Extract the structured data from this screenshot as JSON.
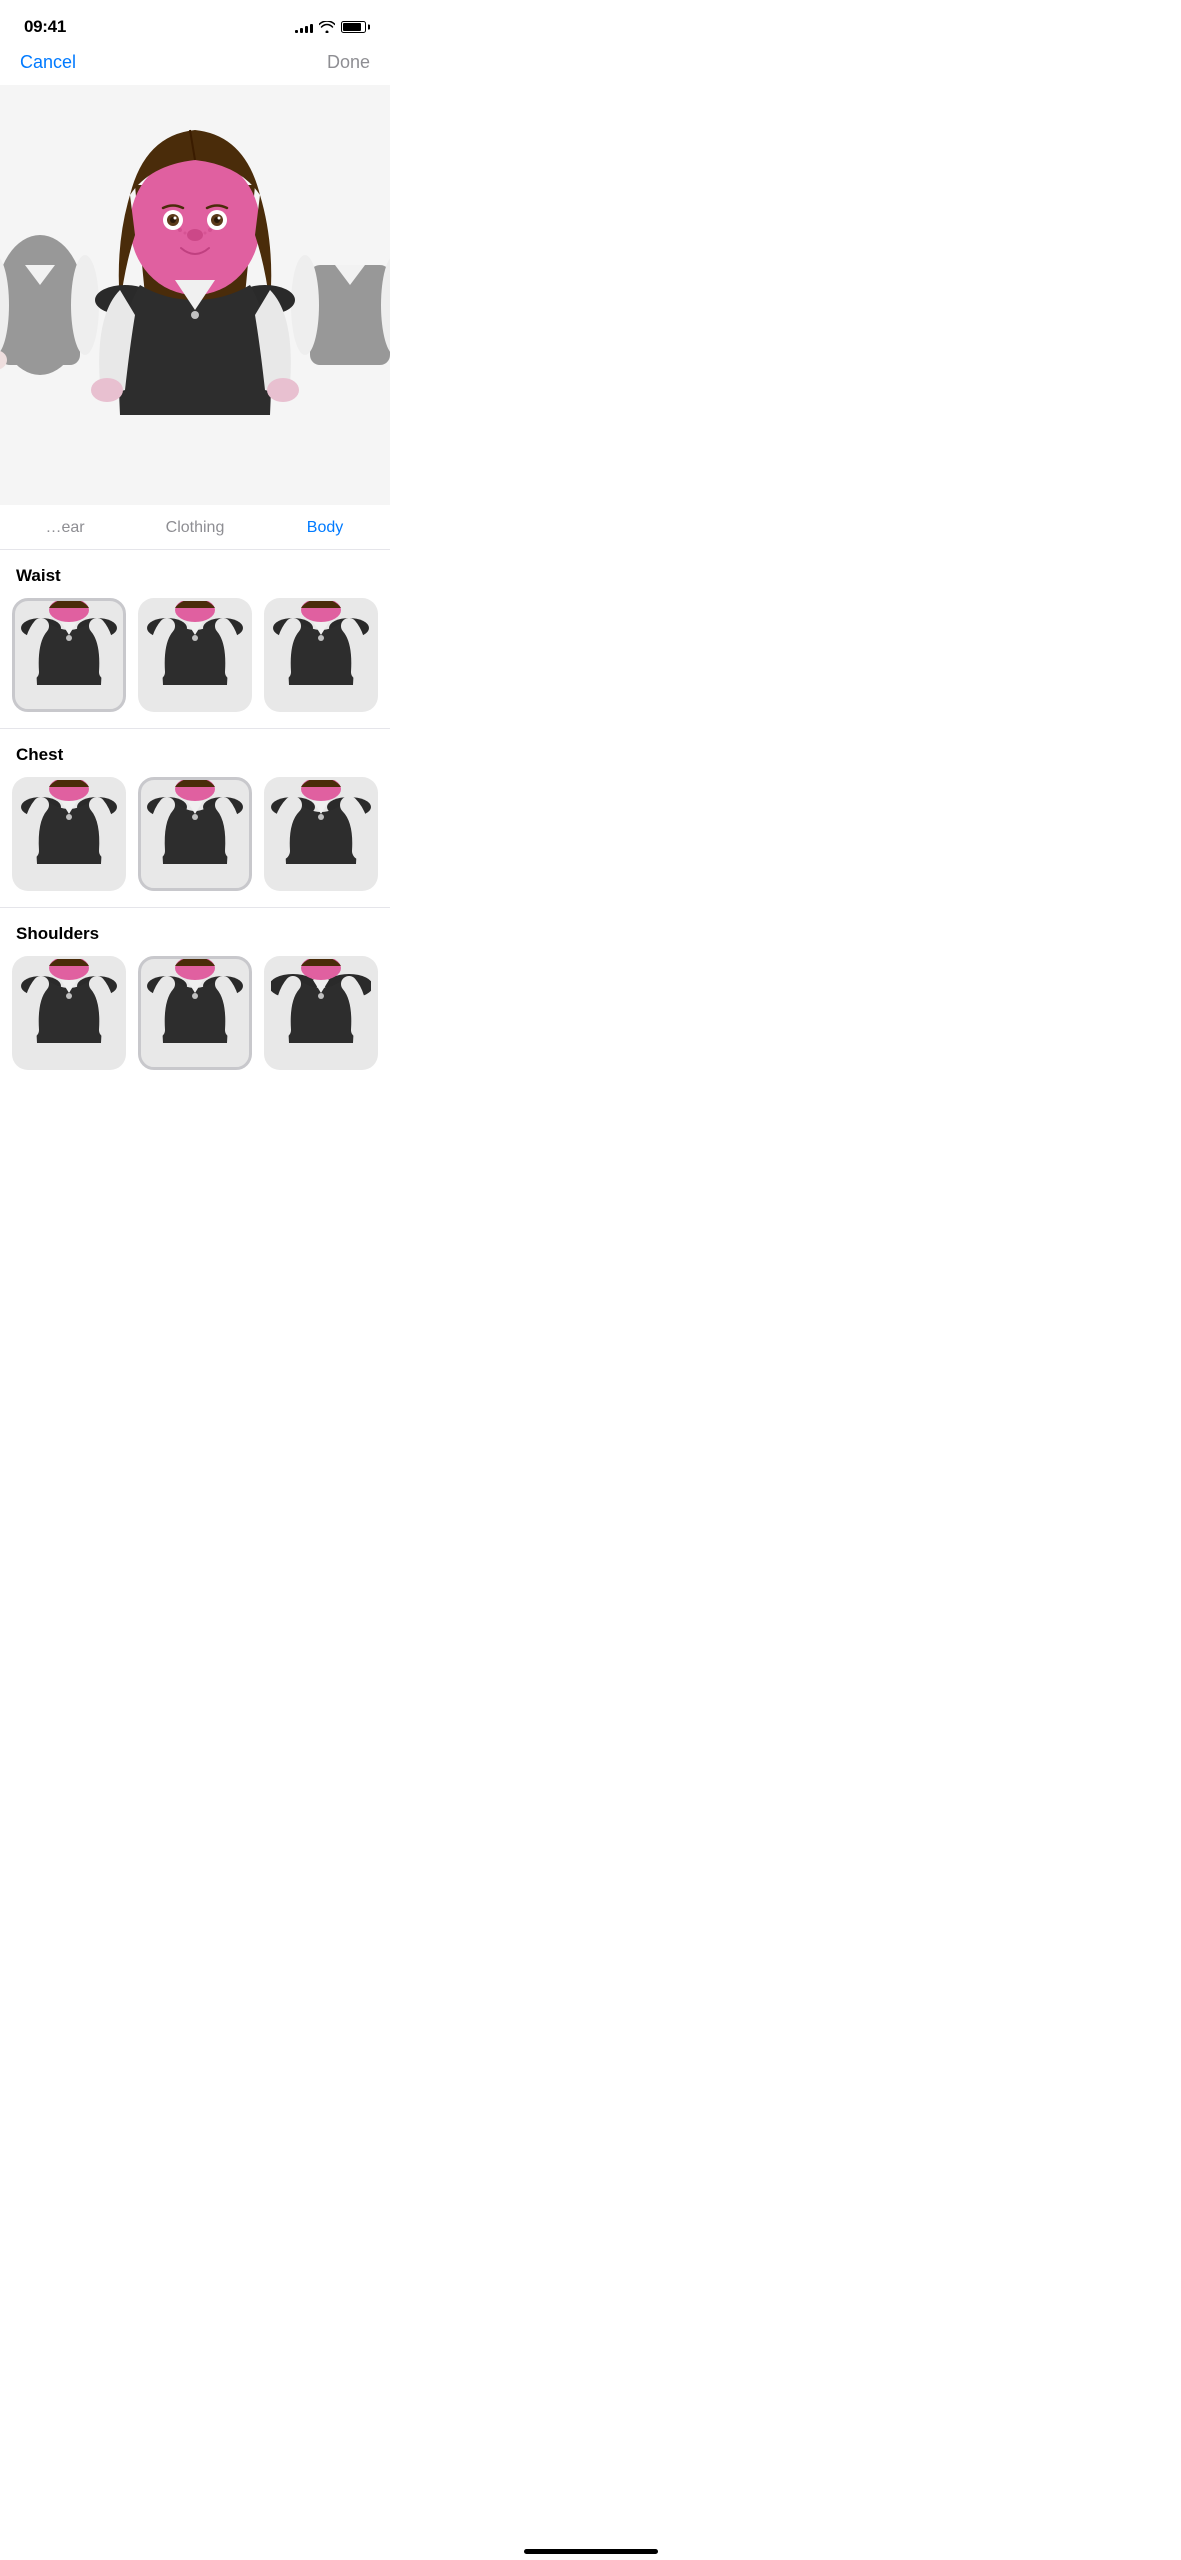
{
  "statusBar": {
    "time": "09:41",
    "signal": [
      3,
      5,
      7,
      9,
      11
    ],
    "battery": 85
  },
  "nav": {
    "cancel": "Cancel",
    "done": "Done"
  },
  "tabs": [
    {
      "id": "headwear",
      "label": "…ear",
      "active": false
    },
    {
      "id": "clothing",
      "label": "Clothing",
      "active": false
    },
    {
      "id": "body",
      "label": "Body",
      "active": true
    }
  ],
  "sections": [
    {
      "id": "waist",
      "title": "Waist",
      "selectedIndex": 0,
      "options": [
        {
          "id": "waist-1",
          "selected": true
        },
        {
          "id": "waist-2",
          "selected": false
        },
        {
          "id": "waist-3",
          "selected": false
        }
      ]
    },
    {
      "id": "chest",
      "title": "Chest",
      "selectedIndex": 1,
      "options": [
        {
          "id": "chest-1",
          "selected": false
        },
        {
          "id": "chest-2",
          "selected": true
        },
        {
          "id": "chest-3",
          "selected": false
        }
      ]
    },
    {
      "id": "shoulders",
      "title": "Shoulders",
      "selectedIndex": 1,
      "options": [
        {
          "id": "shoulders-1",
          "selected": false
        },
        {
          "id": "shoulders-2",
          "selected": true
        },
        {
          "id": "shoulders-3",
          "selected": false
        }
      ]
    }
  ],
  "homeIndicator": {
    "visible": true
  }
}
